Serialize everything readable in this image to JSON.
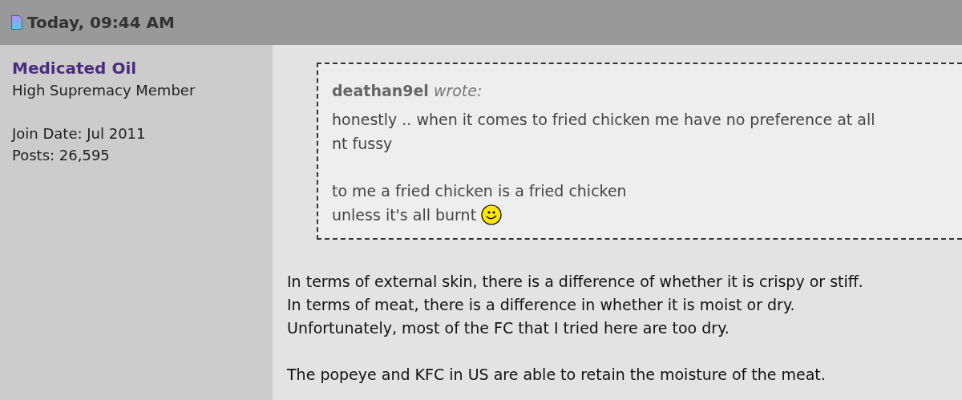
{
  "post_header": {
    "date": "Today, 09:44 AM"
  },
  "author": {
    "name": "Medicated Oil",
    "title": "High Supremacy Member",
    "details": [
      "Join Date: Jul 2011",
      "Posts: 26,595"
    ]
  },
  "quote": {
    "author": "deathan9el",
    "verb": "wrote:",
    "paragraphs": [
      [
        "honestly .. when it comes to fried chicken me have no preference at all",
        "nt fussy"
      ],
      [
        "to me a fried chicken is a fried chicken",
        "unless it's all burnt"
      ]
    ]
  },
  "message": [
    [
      "In terms of external skin, there is a difference of whether it is crispy or stiff.",
      "In terms of meat, there is a difference in whether it is moist or dry.",
      "Unfortunately, most of the FC that I tried here are too dry."
    ],
    [
      "The popeye and KFC in US are able to retain the moisture of the meat."
    ]
  ]
}
